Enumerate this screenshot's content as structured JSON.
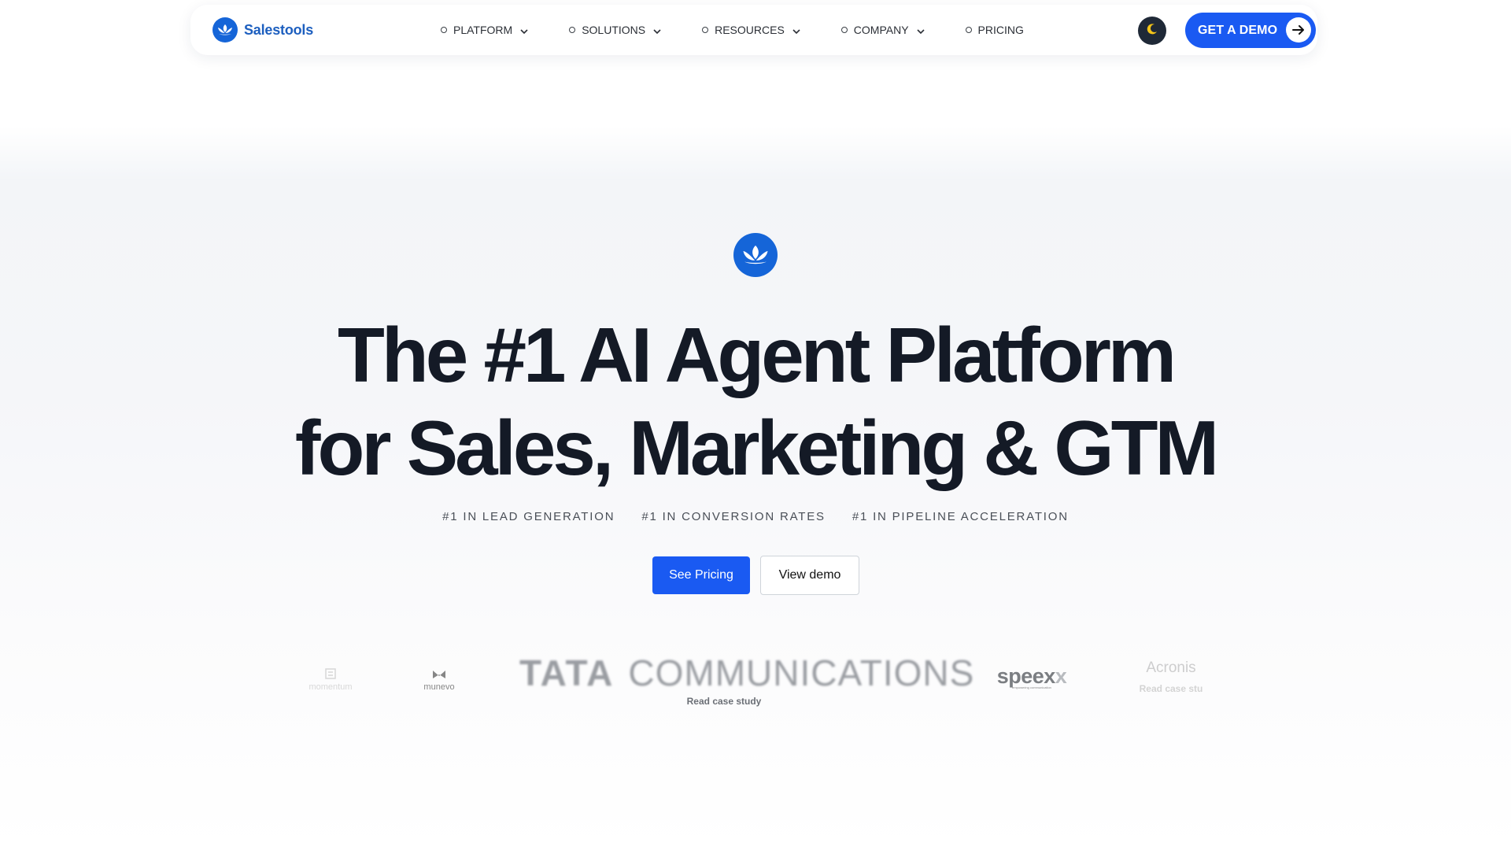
{
  "brand": {
    "name": "Salestools"
  },
  "nav": {
    "items": [
      {
        "label": "PLATFORM",
        "has_dropdown": true
      },
      {
        "label": "SOLUTIONS",
        "has_dropdown": true
      },
      {
        "label": "RESOURCES",
        "has_dropdown": true
      },
      {
        "label": "COMPANY",
        "has_dropdown": true
      },
      {
        "label": "PRICING",
        "has_dropdown": false
      }
    ],
    "theme_toggle_icon": "moon-icon",
    "demo_button": {
      "label": "GET A DEMO",
      "icon": "arrow-right-icon"
    }
  },
  "hero": {
    "headline_line1": "The #1 AI Agent Platform",
    "headline_line2": "for Sales, Marketing & GTM",
    "badges": [
      "#1 IN LEAD GENERATION",
      "#1 IN CONVERSION RATES",
      "#1 IN PIPELINE ACCELERATION"
    ],
    "primary_cta": "See Pricing",
    "secondary_cta": "View demo"
  },
  "logos": {
    "momentum": "momentum",
    "munevo": "munevo",
    "tata_word1": "TATA",
    "tata_word2": "COMMUNICATIONS",
    "tata_case": "Read case study",
    "speexx_main": "speex",
    "speexx_x": "x",
    "speexx_sub": "empowering communication",
    "acronis": "Acronis",
    "acronis_case": "Read case stu"
  },
  "colors": {
    "brand_blue": "#1565d8",
    "accent_blue": "#1a5af2",
    "headline": "#141a26",
    "toggle_bg": "#1f2937",
    "moon": "#f5c518"
  }
}
